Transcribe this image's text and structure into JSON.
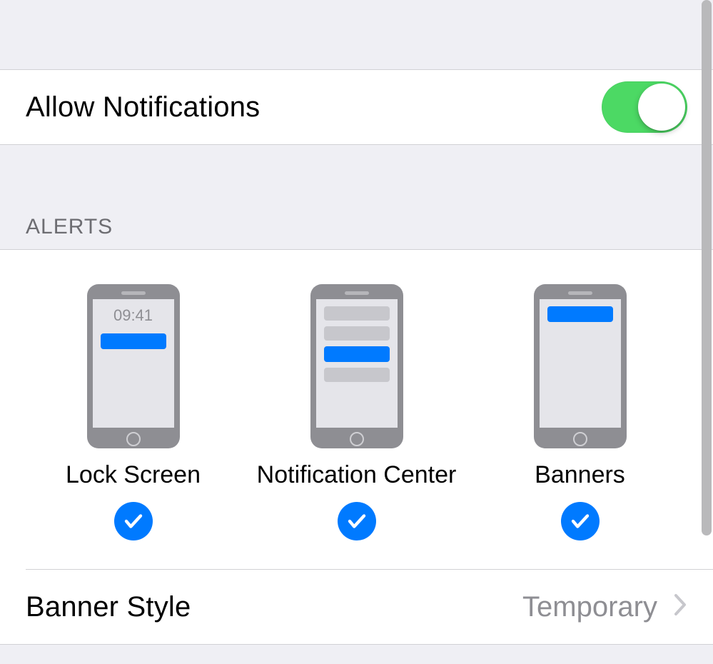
{
  "allow": {
    "label": "Allow Notifications",
    "on": true
  },
  "sections": {
    "alerts_header": "ALERTS"
  },
  "alerts": {
    "lock_screen": {
      "label": "Lock Screen",
      "time": "09:41",
      "checked": true
    },
    "notification_center": {
      "label": "Notification Center",
      "checked": true
    },
    "banners": {
      "label": "Banners",
      "checked": true
    }
  },
  "banner_style": {
    "label": "Banner Style",
    "value": "Temporary"
  }
}
